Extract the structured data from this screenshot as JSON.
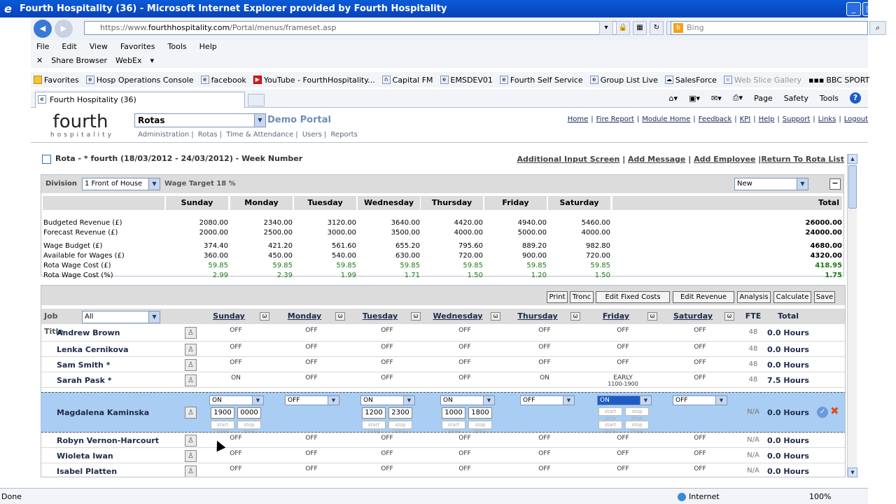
{
  "window": {
    "title": "Fourth Hospitality (36) - Microsoft Internet Explorer provided by Fourth Hospitality"
  },
  "address": {
    "prefix": "https://www.",
    "domain": "fourthhospitality.com",
    "path": "/Portal/menus/frameset.asp",
    "search_placeholder": "Bing"
  },
  "menu": [
    "File",
    "Edit",
    "View",
    "Favorites",
    "Tools",
    "Help"
  ],
  "linkbar": {
    "share": "Share Browser",
    "webex": "WebEx"
  },
  "favorites": {
    "label": "Favorites",
    "items": [
      "Hosp Operations Console",
      "facebook",
      "YouTube - FourthHospitality...",
      "Capital FM",
      "EMSDEV01",
      "Fourth Self Service",
      "Group List Live",
      "SalesForce",
      "Web Slice Gallery",
      "BBC SPORT"
    ]
  },
  "tab": {
    "label": "Fourth Hospitality (36)"
  },
  "commands": [
    "Page",
    "Safety",
    "Tools"
  ],
  "app": {
    "logo_big": "fourth",
    "logo_small": "hospitality",
    "module": "Rotas",
    "portal": "Demo Portal",
    "modmenu": [
      "Administration",
      "Rotas",
      "Time & Attendance",
      "Users",
      "Reports"
    ],
    "toplinks": [
      "Home",
      "Fire Report",
      "Module Home",
      "Feedback",
      "KPI",
      "Help",
      "Support",
      "Links",
      "Logout"
    ]
  },
  "rota": {
    "heading": "Rota - * fourth (18/03/2012 - 24/03/2012) - Week Number",
    "links": [
      "Additional Input Screen",
      "Add Message",
      "Add Employee",
      "Return To Rota List"
    ]
  },
  "budget": {
    "division_label": "Division",
    "division_value": "1 Front of House",
    "wage_target": "Wage Target 18 %",
    "new_value": "New",
    "days": [
      "Sunday",
      "Monday",
      "Tuesday",
      "Wednesday",
      "Thursday",
      "Friday",
      "Saturday"
    ],
    "total_label": "Total",
    "rows": [
      {
        "label": "Budgeted Revenue (£)",
        "values": [
          "2080.00",
          "2340.00",
          "3120.00",
          "3640.00",
          "4420.00",
          "4940.00",
          "5460.00"
        ],
        "total": "26000.00",
        "green": false
      },
      {
        "label": "Forecast Revenue (£)",
        "values": [
          "2000.00",
          "2500.00",
          "3000.00",
          "3500.00",
          "4000.00",
          "5000.00",
          "4000.00"
        ],
        "total": "24000.00",
        "green": false
      },
      {
        "label": "Wage Budget (£)",
        "values": [
          "374.40",
          "421.20",
          "561.60",
          "655.20",
          "795.60",
          "889.20",
          "982.80"
        ],
        "total": "4680.00",
        "green": false
      },
      {
        "label": "Available for Wages (£)",
        "values": [
          "360.00",
          "450.00",
          "540.00",
          "630.00",
          "720.00",
          "900.00",
          "720.00"
        ],
        "total": "4320.00",
        "green": false
      },
      {
        "label": "Rota Wage Cost (£)",
        "values": [
          "59.85",
          "59.85",
          "59.85",
          "59.85",
          "59.85",
          "59.85",
          "59.85"
        ],
        "total": "418.95",
        "green": true
      },
      {
        "label": "Rota Wage Cost (%)",
        "values": [
          "2.99",
          "2.39",
          "1.99",
          "1.71",
          "1.50",
          "1.20",
          "1.50"
        ],
        "total": "1.75",
        "green": true
      }
    ]
  },
  "toolbar": {
    "buttons": [
      "Print",
      "Tronc",
      "Edit Fixed Costs",
      "Edit Revenue",
      "Analysis",
      "Calculate",
      "Save"
    ]
  },
  "staff_header": {
    "job_title": "Job Title",
    "job_value": "All",
    "fte": "FTE",
    "total": "Total"
  },
  "staff": [
    {
      "name": "Andrew Brown",
      "days": [
        "OFF",
        "OFF",
        "OFF",
        "OFF",
        "OFF",
        "OFF",
        "OFF"
      ],
      "fte": "48",
      "total": "0.0 Hours"
    },
    {
      "name": "Lenka Cernikova",
      "days": [
        "OFF",
        "OFF",
        "OFF",
        "OFF",
        "OFF",
        "OFF",
        "OFF"
      ],
      "fte": "48",
      "total": "0.0 Hours"
    },
    {
      "name": "Sam Smith *",
      "days": [
        "OFF",
        "OFF",
        "OFF",
        "OFF",
        "OFF",
        "OFF",
        "OFF"
      ],
      "fte": "48",
      "total": "0.0 Hours"
    },
    {
      "name": "Sarah Pask *",
      "days": [
        "ON",
        "OFF",
        "OFF",
        "OFF",
        "ON",
        "EARLY",
        "OFF"
      ],
      "friday_time": "1100-1900",
      "fte": "48",
      "total": "7.5 Hours"
    },
    {
      "name": "Magdalena Kaminska",
      "fte": "N/A",
      "total": "0.0 Hours"
    },
    {
      "name": "Robyn Vernon-Harcourt",
      "days": [
        "OFF",
        "OFF",
        "OFF",
        "OFF",
        "OFF",
        "OFF",
        "OFF"
      ],
      "fte": "N/A",
      "total": "0.0 Hours"
    },
    {
      "name": "Wioleta Iwan",
      "days": [
        "OFF",
        "OFF",
        "OFF",
        "OFF",
        "OFF",
        "OFF",
        "OFF"
      ],
      "fte": "N/A",
      "total": "0.0 Hours"
    },
    {
      "name": "Isabel Platten",
      "days": [
        "OFF",
        "OFF",
        "OFF",
        "OFF",
        "OFF",
        "OFF",
        "OFF"
      ],
      "fte": "N/A",
      "total": "0.0 Hours"
    }
  ],
  "edit_row": {
    "selects": [
      "ON",
      "OFF",
      "ON",
      "ON",
      "OFF",
      "ON",
      "OFF"
    ],
    "sun": [
      "1900",
      "0000"
    ],
    "tue": [
      "1200",
      "2300"
    ],
    "wed": [
      "1000",
      "1800"
    ],
    "start_ph": "start time",
    "stop_ph": "stop time"
  },
  "status": {
    "left": "Done",
    "zone": "Internet",
    "zoom": "100%"
  }
}
